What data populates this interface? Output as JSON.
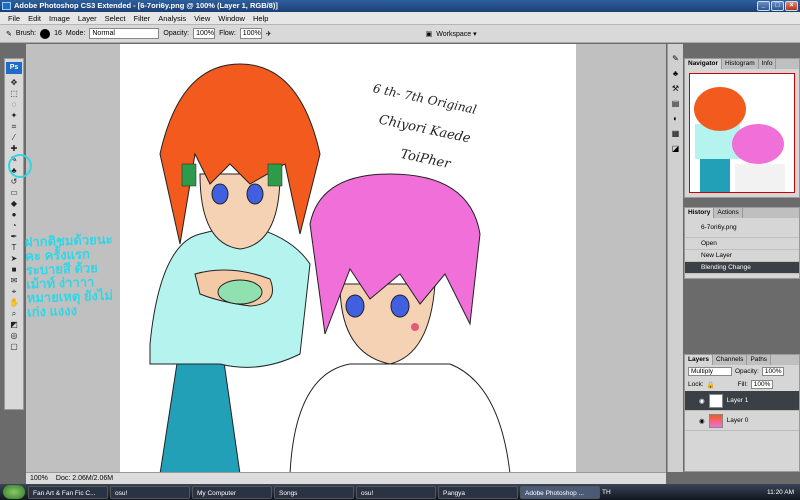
{
  "window": {
    "title": "Adobe Photoshop CS3 Extended - [6-7ori6y.png @ 100% (Layer 1, RGB/8)]"
  },
  "menu": [
    "File",
    "Edit",
    "Image",
    "Layer",
    "Select",
    "Filter",
    "Analysis",
    "View",
    "Window",
    "Help"
  ],
  "options": {
    "brush_label": "Brush:",
    "brush_size": "16",
    "mode_label": "Mode:",
    "mode_value": "Normal",
    "opacity_label": "Opacity:",
    "opacity_value": "100%",
    "flow_label": "Flow:",
    "flow_value": "100%",
    "workspace": "Workspace ▾"
  },
  "canvas_text": {
    "line1": "6 th- 7th Original",
    "line2": "Chiyori Kaede",
    "line3": "ToiPher",
    "thai_note": "ฝากติชมด้วยนะคะ ครั้งแรก ระบายสี ด้วยเม้าท์ ง่าาาา หมายเหตุ ยังไม่เก่ง แงงง"
  },
  "status": {
    "zoom": "100%",
    "doc": "Doc: 2.06M/2.06M"
  },
  "navigator": {
    "tabs": [
      "Navigator",
      "Histogram",
      "Info"
    ]
  },
  "history": {
    "tabs": [
      "History",
      "Actions"
    ],
    "snapshot": "6-7ori6y.png",
    "steps": [
      "Open",
      "New Layer",
      "Blending Change"
    ]
  },
  "layers": {
    "tabs": [
      "Layers",
      "Channels",
      "Paths"
    ],
    "blend_mode": "Multiply",
    "opacity_label": "Opacity:",
    "opacity_value": "100%",
    "lock_label": "Lock:",
    "fill_label": "Fill:",
    "fill_value": "100%",
    "rows": [
      "Layer 1",
      "Layer 0"
    ]
  },
  "taskbar": {
    "tasks": [
      "Fan Art & Fan Fic C...",
      "osu!",
      "My Computer",
      "Songs",
      "osu!",
      "Pangya",
      "Adobe Photoshop ..."
    ],
    "lang": "TH",
    "time": "11:20 AM"
  },
  "colors": {
    "hair_orange": "#f25a1e",
    "hair_pink": "#f06fd8",
    "shirt_cyan": "#b5f3ee",
    "pants": "#22a0b8"
  }
}
